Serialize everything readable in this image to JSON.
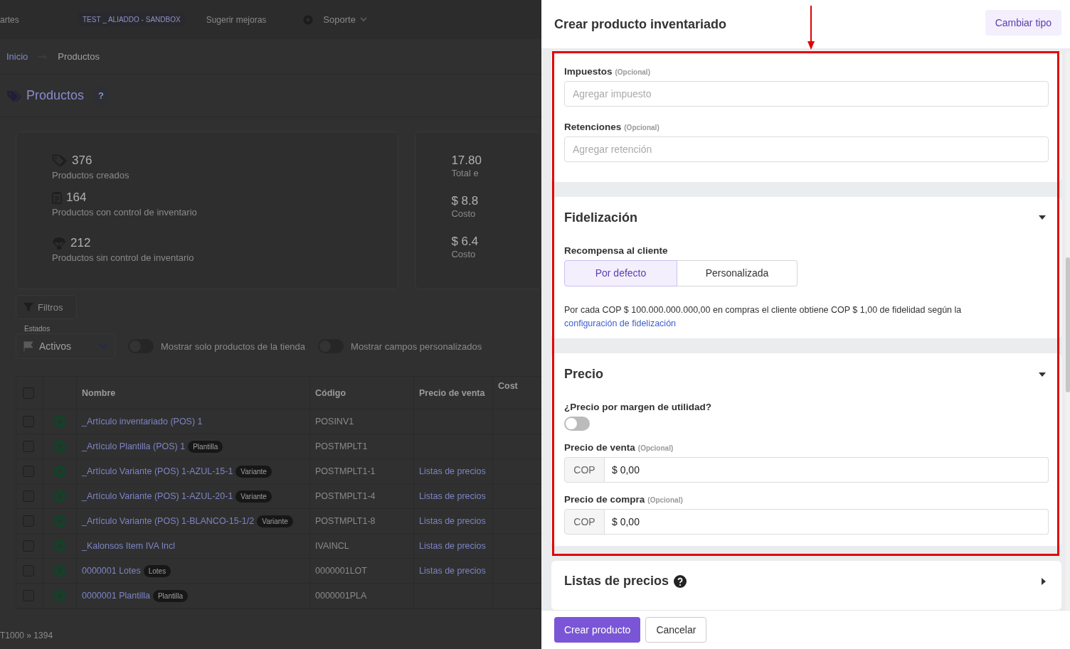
{
  "background": {
    "topbar": [
      {
        "text": "artes",
        "kind": "plain"
      },
      {
        "text": "TEST _ ALIADDO - SANDBOX",
        "kind": "badge"
      },
      {
        "text": "Sugerir mejoras",
        "kind": "plain"
      },
      {
        "text": "Soporte",
        "kind": "menu"
      }
    ],
    "breadcrumb": [
      "Inicio",
      "Productos"
    ],
    "title": "Productos",
    "help": "?",
    "stats": [
      {
        "value": "376",
        "label": "Productos creados"
      },
      {
        "value": "164",
        "label": "Productos con control de inventario"
      },
      {
        "value": "212",
        "label": "Productos sin control de inventario"
      }
    ],
    "totals": [
      {
        "value": "17.80",
        "label": "Total e"
      },
      {
        "value": "$ 8.8",
        "label": "Costo"
      },
      {
        "value": "$ 6.4",
        "label": "Costo"
      }
    ],
    "filters_button": "Filtros",
    "status_select": {
      "label": "Estados",
      "value": "Activos"
    },
    "toggles": [
      {
        "label": "Mostrar solo productos de la tienda",
        "on": false
      },
      {
        "label": "Mostrar campos personalizados",
        "on": false
      }
    ],
    "table": {
      "select_all_checked": false,
      "columns": [
        "Nombre",
        "Código",
        "Precio de venta",
        "Cost"
      ],
      "rows": [
        {
          "checked": false,
          "name": {
            "text": "_Artículo inventariado (POS) 1"
          },
          "code": "POSINV1"
        },
        {
          "checked": false,
          "name": {
            "text": "_Artículo Plantilla (POS) 1",
            "badge": "Plantilla"
          },
          "code": "POSTMPLT1"
        },
        {
          "checked": false,
          "name": {
            "text": "_Artículo Variante (POS) 1-AZUL-15-1",
            "badge": "Variante"
          },
          "code": "POSTMPLT1-1",
          "price": "Listas de precios"
        },
        {
          "checked": false,
          "name": {
            "text": "_Artículo Variante (POS) 1-AZUL-20-1",
            "badge": "Variante"
          },
          "code": "POSTMPLT1-4",
          "price": "Listas de precios"
        },
        {
          "checked": false,
          "name": {
            "text": "_Artículo Variante (POS) 1-BLANCO-15-1/2",
            "badge": "Variante"
          },
          "code": "POSTMPLT1-8",
          "price": "Listas de precios"
        },
        {
          "checked": false,
          "name": {
            "text": "_Kalonsos Item IVA Incl"
          },
          "code": "IVAINCL",
          "price": "Listas de precios"
        },
        {
          "checked": false,
          "name": {
            "text": "0000001 Lotes",
            "badge": "Lotes"
          },
          "code": "0000001LOT",
          "price": "Listas de precios"
        },
        {
          "checked": false,
          "name": {
            "text": "0000001 Plantilla",
            "badge": "Plantilla"
          },
          "code": "0000001PLA"
        }
      ]
    },
    "pagination": "T1000 » 1394"
  },
  "drawer": {
    "title": "Crear producto inventariado",
    "change_type_button": "Cambiar tipo",
    "taxes": [
      {
        "label": "Impuestos",
        "optional": "(Opcional)",
        "placeholder": "Agregar impuesto"
      },
      {
        "label": "Retenciones",
        "optional": "(Opcional)",
        "placeholder": "Agregar retención"
      }
    ],
    "loyalty": {
      "title": "Fidelización",
      "expanded": true,
      "reward_label": "Recompensa al cliente",
      "options": [
        {
          "label": "Por defecto",
          "selected": true
        },
        {
          "label": "Personalizada",
          "selected": false
        }
      ],
      "description": "Por cada COP $ 100.000.000.000,00 en compras el cliente obtiene COP $ 1,00 de fidelidad según la",
      "link": "configuración de fidelización"
    },
    "price": {
      "title": "Precio",
      "expanded": true,
      "margin_toggle": {
        "label": "¿Precio por margen de utilidad?",
        "on": false
      },
      "fields": [
        {
          "label": "Precio de venta",
          "optional": "(Opcional)",
          "currency": "COP",
          "value": "$ 0,00"
        },
        {
          "label": "Precio de compra",
          "optional": "(Opcional)",
          "currency": "COP",
          "value": "$ 0,00"
        }
      ]
    },
    "price_lists": {
      "title": "Listas de precios",
      "expanded": false
    },
    "buttons": [
      {
        "label": "Crear producto",
        "kind": "primary"
      },
      {
        "label": "Cancelar",
        "kind": "secondary"
      }
    ]
  }
}
